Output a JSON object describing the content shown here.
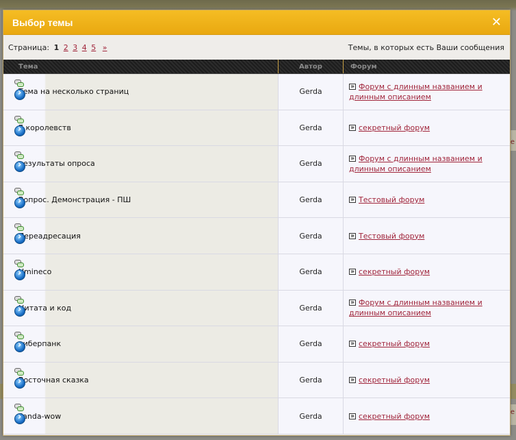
{
  "background": {
    "side_marks": [
      "е",
      "е",
      "е"
    ]
  },
  "modal": {
    "title": "Выбор темы",
    "close_symbol": "✕"
  },
  "toolbar": {
    "page_label": "Страница:",
    "pages": [
      "1",
      "2",
      "3",
      "4",
      "5"
    ],
    "current_page": "1",
    "next_symbol": "»",
    "filter_label": "Темы, в которых есть Ваши сообщения"
  },
  "table": {
    "headers": {
      "topic": "Тема",
      "author": "Автор",
      "forum": "Форум"
    },
    "rows": [
      {
        "topic": "Тема на несколько страниц",
        "author": "Gerda",
        "forum": "Форум с длинным названием и длинным описанием"
      },
      {
        "topic": "7 королевств",
        "author": "Gerda",
        "forum": "секретный форум"
      },
      {
        "topic": "результаты опроса",
        "author": "Gerda",
        "forum": "Форум с длинным названием и длинным описанием"
      },
      {
        "topic": "Вопрос. Демонстрация - ПШ",
        "author": "Gerda",
        "forum": "Тестовый форум"
      },
      {
        "topic": "Переадресация",
        "author": "Gerda",
        "forum": "Тестовый форум"
      },
      {
        "topic": "Umineco",
        "author": "Gerda",
        "forum": "секретный форум"
      },
      {
        "topic": "Цитата и код",
        "author": "Gerda",
        "forum": "Форум с длинным названием и длинным описанием"
      },
      {
        "topic": "киберпанк",
        "author": "Gerda",
        "forum": "секретный форум"
      },
      {
        "topic": "Восточная сказка",
        "author": "Gerda",
        "forum": "секретный форум"
      },
      {
        "topic": "Panda-wow",
        "author": "Gerda",
        "forum": "секретный форум"
      }
    ]
  },
  "colors": {
    "titlebar": "#f0b11a",
    "link": "#a0243a",
    "header_bg": "#262626"
  }
}
